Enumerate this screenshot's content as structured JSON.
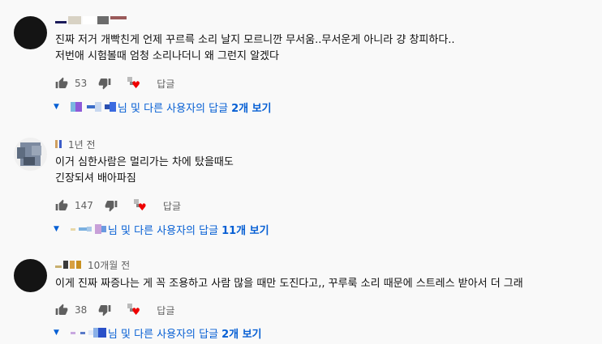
{
  "comments": [
    {
      "time": "",
      "lines": [
        "진짜 저거 개빡친게 언제 꾸르륵 소리 날지 모르니깐 무서움..무서운게 아니라 걍 창피하다..",
        "저번애 시험볼때 엄청 소리나더니 왜 그런지 알겠다"
      ],
      "likes": "53",
      "reply_button": "답글",
      "replies_label": "님 및 다른 사용자의 답글",
      "replies_count": "2개 보기"
    },
    {
      "time": "1년 전",
      "lines": [
        "이거 심한사람은 멀리가는 차에 탔을때도",
        "긴장되셔 배아파짐"
      ],
      "likes": "147",
      "reply_button": "답글",
      "replies_label": "님 및 다른 사용자의 답글",
      "replies_count": "11개 보기"
    },
    {
      "time": "10개월 전",
      "lines": [
        "이게 진짜 짜증나는 게 꼭 조용하고 사람 많을 때만 도진다고,, 꾸루룩 소리 때문에 스트레스 받아서 더 그래"
      ],
      "likes": "38",
      "reply_button": "답글",
      "replies_label": "님 및 다른 사용자의 답글",
      "replies_count": "2개 보기"
    }
  ],
  "icons": {
    "like": "thumbs-up-icon",
    "dislike": "thumbs-down-icon",
    "heart": "creator-heart-icon",
    "expand": "caret-down-icon"
  },
  "colors": {
    "background": "#f9f9f9",
    "link_blue": "#065fd4",
    "meta_gray": "#606060",
    "heart_red": "#ee0000"
  }
}
